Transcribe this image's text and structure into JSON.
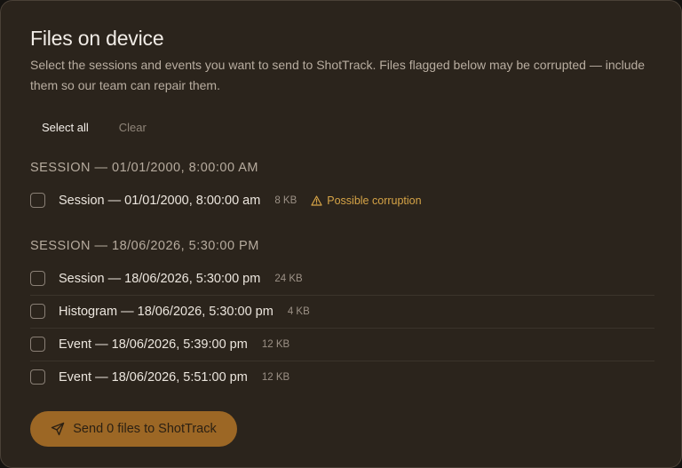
{
  "dialog": {
    "title": "Files on device",
    "description": "Select the sessions and events you want to send to ShotTrack. Files flagged below may be corrupted — include them so our team can repair them."
  },
  "actions": {
    "select_all_label": "Select all",
    "clear_label": "Clear"
  },
  "groups": [
    {
      "header": "SESSION — 01/01/2000, 8:00:00 AM",
      "files": [
        {
          "name": "Session — 01/01/2000, 8:00:00 am",
          "size": "8 KB",
          "checked": false,
          "warning": "Possible corruption"
        }
      ]
    },
    {
      "header": "SESSION — 18/06/2026, 5:30:00 PM",
      "files": [
        {
          "name": "Session — 18/06/2026, 5:30:00 pm",
          "size": "24 KB",
          "checked": false
        },
        {
          "name": "Histogram — 18/06/2026, 5:30:00 pm",
          "size": "4 KB",
          "checked": false
        },
        {
          "name": "Event — 18/06/2026, 5:39:00 pm",
          "size": "12 KB",
          "checked": false
        },
        {
          "name": "Event — 18/06/2026, 5:51:00 pm",
          "size": "12 KB",
          "checked": false
        }
      ]
    }
  ],
  "send_button": {
    "label": "Send 0 files to ShotTrack",
    "icon": "send-icon"
  },
  "colors": {
    "panel_background": "#2b241c",
    "accent": "#9c6725",
    "warning": "#d6a447"
  }
}
